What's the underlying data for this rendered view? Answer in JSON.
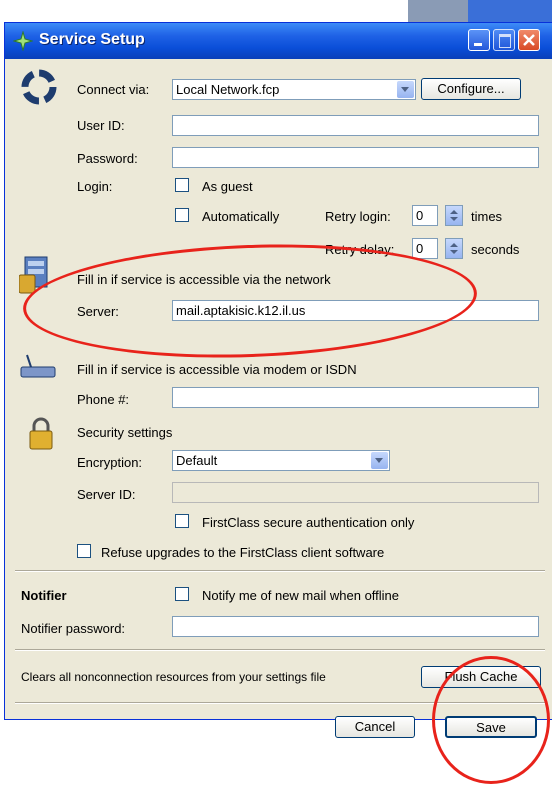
{
  "window": {
    "title": "Service Setup"
  },
  "connect": {
    "label": "Connect via:",
    "value": "Local Network.fcp",
    "configure": "Configure..."
  },
  "userid": {
    "label": "User ID:",
    "value": ""
  },
  "password": {
    "label": "Password:",
    "value": ""
  },
  "login": {
    "label": "Login:",
    "as_guest": "As guest",
    "automatically": "Automatically",
    "retry_login_label": "Retry login:",
    "retry_login_value": "0",
    "retry_login_unit": "times",
    "retry_delay_label": "Retry delay:",
    "retry_delay_value": "0",
    "retry_delay_unit": "seconds"
  },
  "network": {
    "hint": "Fill in if service is accessible via the network",
    "server_label": "Server:",
    "server_value": "mail.aptakisic.k12.il.us"
  },
  "modem": {
    "hint": "Fill in if service is accessible via modem or ISDN",
    "phone_label": "Phone #:",
    "phone_value": ""
  },
  "security": {
    "heading": "Security settings",
    "encryption_label": "Encryption:",
    "encryption_value": "Default",
    "serverid_label": "Server ID:",
    "serverid_value": "",
    "secure_auth": "FirstClass secure authentication only",
    "refuse_upgrades": "Refuse upgrades to the FirstClass client software"
  },
  "notifier": {
    "heading": "Notifier",
    "notify_offline": "Notify me of new mail when offline",
    "password_label": "Notifier password:",
    "password_value": ""
  },
  "cache": {
    "description": "Clears all nonconnection resources from your settings file",
    "flush": "Flush Cache"
  },
  "footer": {
    "cancel": "Cancel",
    "save": "Save"
  },
  "colors": {
    "titlebar": "#0a4ed8",
    "dialog_bg": "#ece9d8",
    "annotation": "#e8231b",
    "close_button": "#e2572f"
  }
}
